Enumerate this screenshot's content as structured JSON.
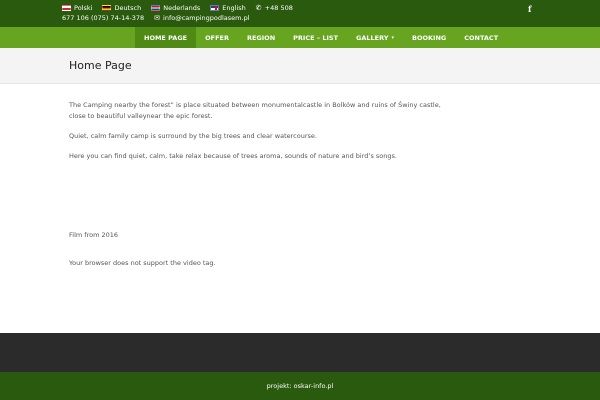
{
  "topbar": {
    "languages": [
      {
        "label": "Polski",
        "flag": "pl-flag"
      },
      {
        "label": "Deutsch",
        "flag": "de-flag"
      },
      {
        "label": "Nederlands",
        "flag": "nl-flag"
      },
      {
        "label": "English",
        "flag": "en-flag"
      }
    ],
    "phone_prefix": "+48 508",
    "phone_rest": "677 106 (075) 74-14-378",
    "email": "info@campingpodlasem.pl",
    "social_icon": "facebook-icon",
    "social_glyph": "f",
    "phone_glyph": "✆",
    "email_glyph": "✉"
  },
  "nav": {
    "items": [
      {
        "label": "HOME PAGE",
        "active": true
      },
      {
        "label": "OFFER"
      },
      {
        "label": "REGION"
      },
      {
        "label": "PRICE – LIST"
      },
      {
        "label": "GALLERY",
        "dropdown": true
      },
      {
        "label": "BOOKING"
      },
      {
        "label": "CONTACT"
      }
    ],
    "chevron_glyph": "▾"
  },
  "page": {
    "title": "Home Page",
    "paragraphs": [
      "The Camping nearby the forest” is place situated between monumentalcastle in Bolków and ruins of Świny castle, close to beautiful valleynear the epic forest.",
      "Quiet, calm family camp is surround by the big trees and clear watercourse.",
      "Here you can find quiet, calm, take relax because of trees aroma, sounds of nature and bird’s songs."
    ],
    "film_label": "Film from 2016",
    "video_fallback": "Your browser does not support the video tag."
  },
  "footer": {
    "credit": "projekt: oskar-info.pl"
  },
  "colors": {
    "topbar": "#2a5a0e",
    "nav": "#67a520",
    "nav_active": "#4f8a14",
    "footer_dark": "#2b2b2b"
  }
}
